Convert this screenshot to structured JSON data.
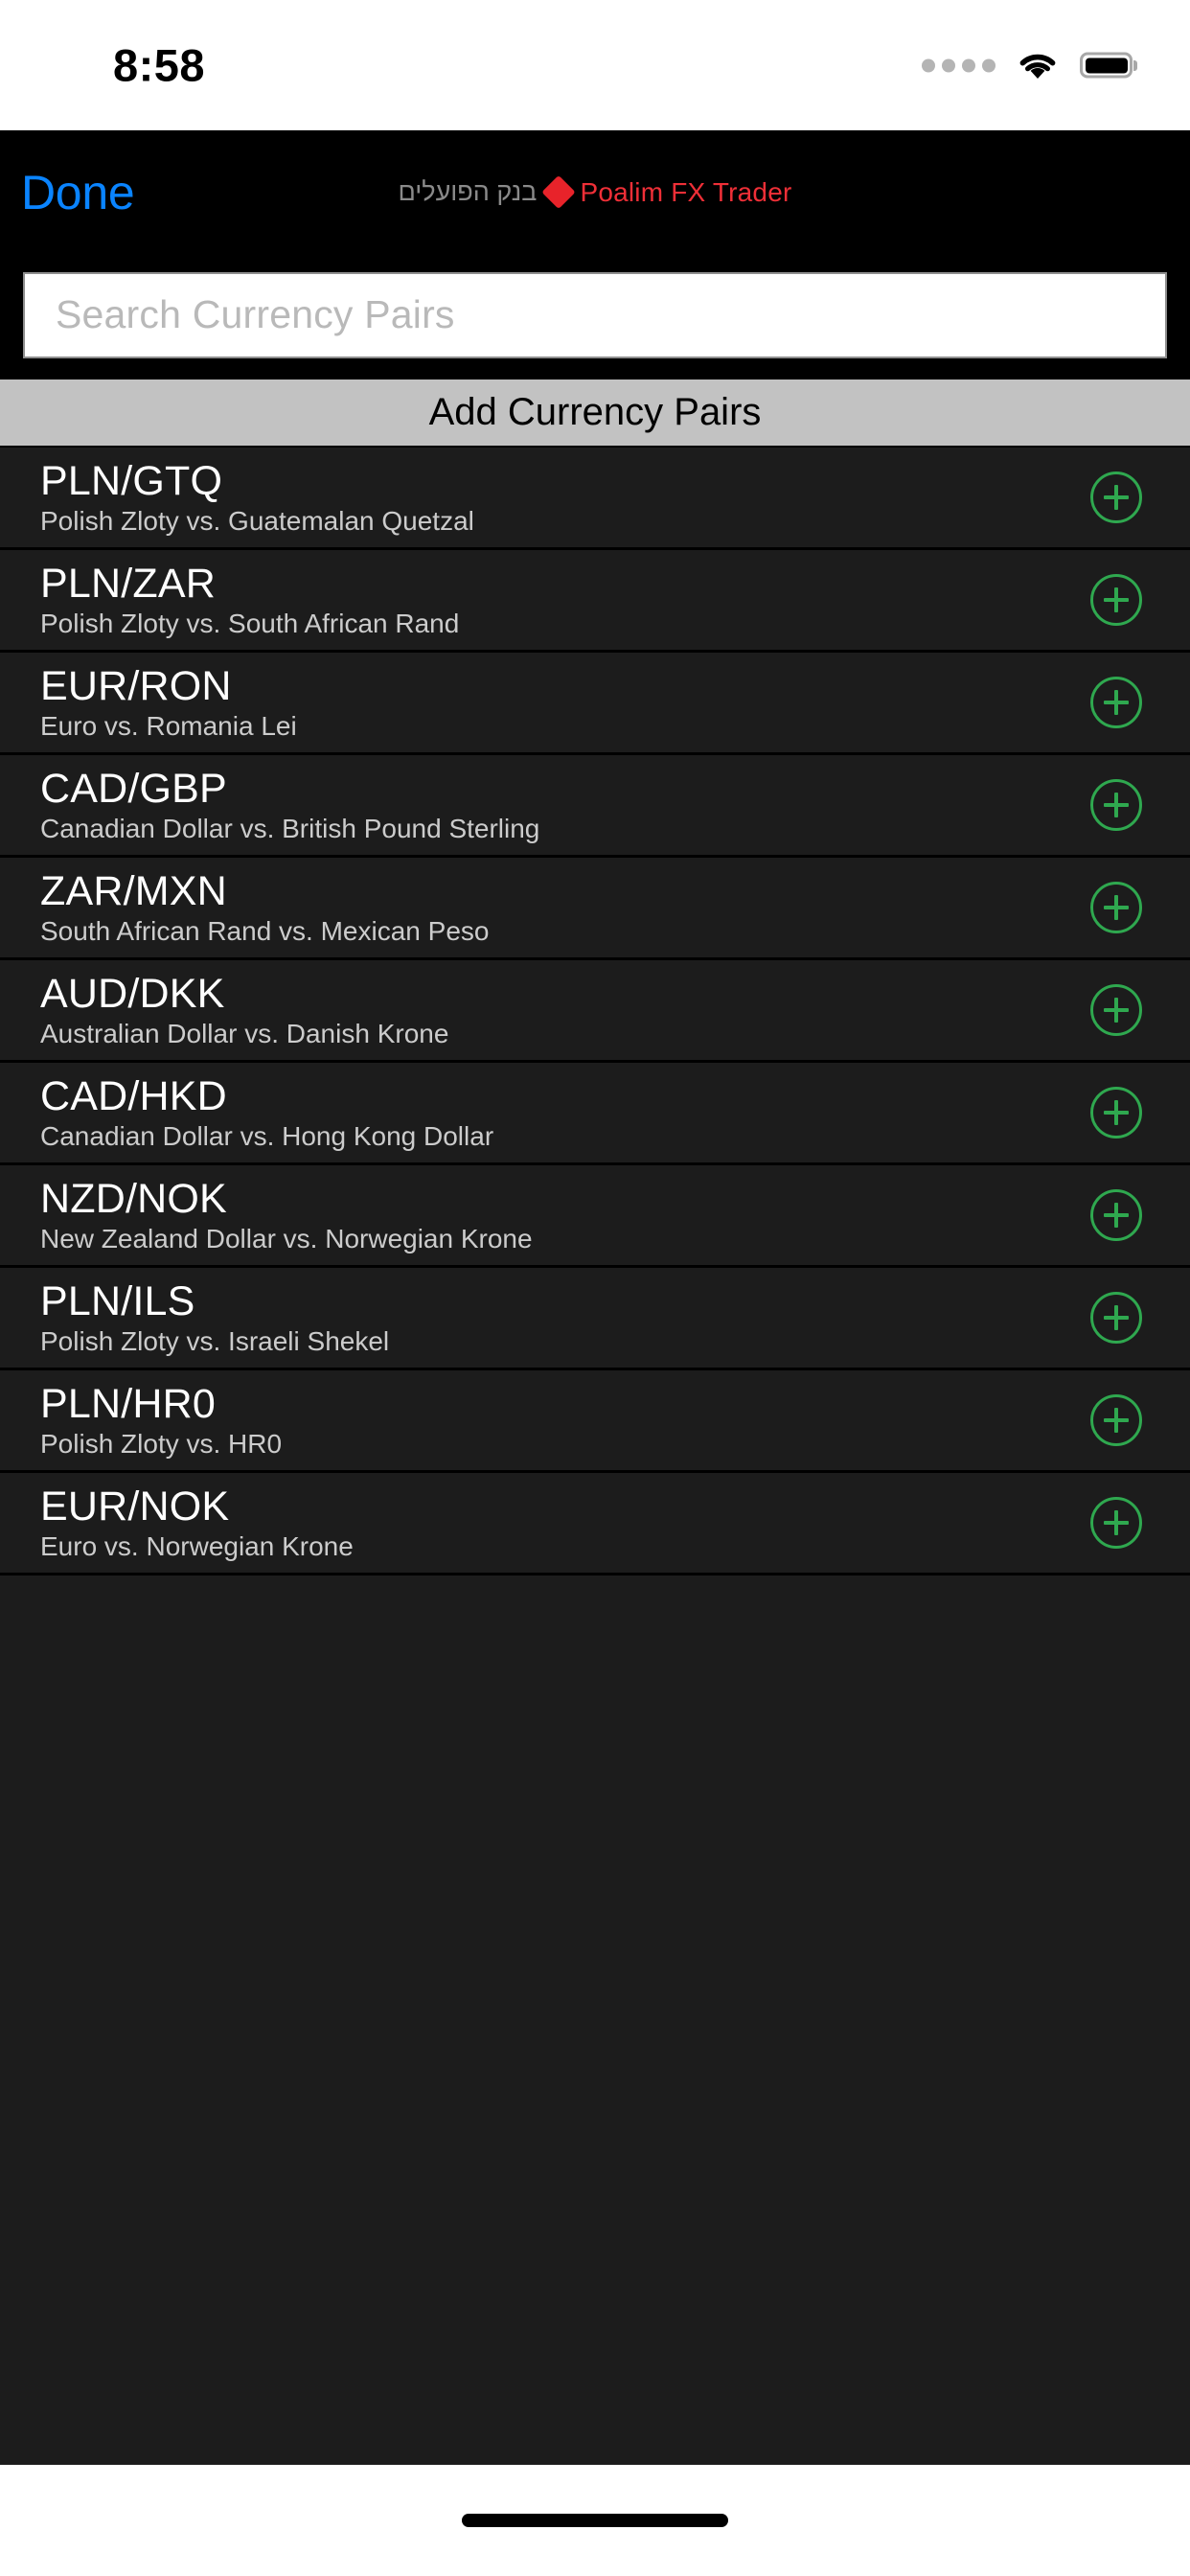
{
  "status_bar": {
    "time": "8:58",
    "signal_icon": "signal-dots-icon",
    "wifi_icon": "wifi-icon",
    "battery_icon": "battery-full-icon"
  },
  "nav_bar": {
    "done_label": "Done",
    "title_hebrew": "בנק הפועלים",
    "logo_icon": "red-diamond-logo-icon",
    "title_english": "Poalim FX Trader",
    "done_color": "#0a84ff",
    "brand_red": "#ef2f37"
  },
  "search": {
    "placeholder": "Search Currency Pairs",
    "value": ""
  },
  "section_header": {
    "label": "Add Currency Pairs"
  },
  "list": {
    "add_icon": "plus-circle-icon",
    "add_icon_color": "#2fa84f",
    "rows": [
      {
        "pair": "PLN/GTQ",
        "description": "Polish Zloty vs. Guatemalan Quetzal"
      },
      {
        "pair": "PLN/ZAR",
        "description": "Polish Zloty vs. South African Rand"
      },
      {
        "pair": "EUR/RON",
        "description": "Euro vs. Romania Lei"
      },
      {
        "pair": "CAD/GBP",
        "description": "Canadian Dollar vs. British Pound Sterling"
      },
      {
        "pair": "ZAR/MXN",
        "description": "South African Rand vs. Mexican Peso"
      },
      {
        "pair": "AUD/DKK",
        "description": "Australian Dollar vs. Danish Krone"
      },
      {
        "pair": "CAD/HKD",
        "description": "Canadian Dollar vs. Hong Kong Dollar"
      },
      {
        "pair": "NZD/NOK",
        "description": "New Zealand Dollar vs. Norwegian Krone"
      },
      {
        "pair": "PLN/ILS",
        "description": "Polish Zloty vs. Israeli Shekel"
      },
      {
        "pair": "PLN/HR0",
        "description": "Polish Zloty vs. HR0"
      },
      {
        "pair": "EUR/NOK",
        "description": "Euro vs. Norwegian Krone"
      }
    ]
  },
  "home_indicator": {
    "icon": "home-indicator-bar"
  }
}
